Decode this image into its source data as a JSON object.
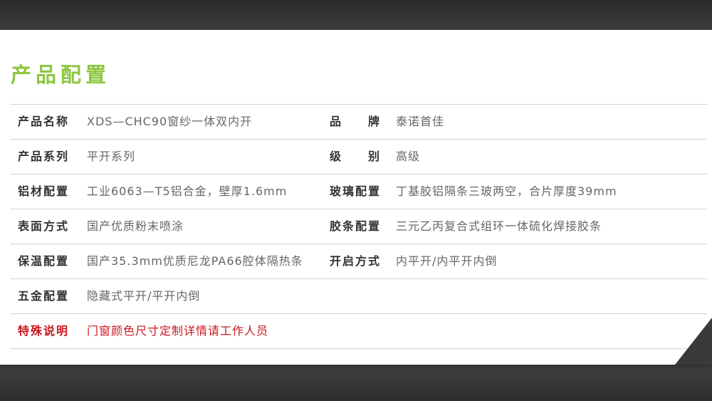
{
  "title": "产品配置",
  "colors": {
    "title": "#8cc63f",
    "highlight": "#c8161d"
  },
  "rows": [
    {
      "l1": "产品名称",
      "v1": "XDS—CHC90窗纱一体双内开",
      "l2": "品　　牌",
      "v2": "泰诺首佳"
    },
    {
      "l1": "产品系列",
      "v1": "平开系列",
      "l2": "级　　别",
      "v2": "高级"
    },
    {
      "l1": "铝材配置",
      "v1": "工业6063—T5铝合金，壁厚1.6mm",
      "l2": "玻璃配置",
      "v2": "丁基胶铝隔条三玻两空，合片厚度39mm"
    },
    {
      "l1": "表面方式",
      "v1": "国产优质粉末喷涂",
      "l2": "胶条配置",
      "v2": "三元乙丙复合式组环一体硫化焊接胶条"
    },
    {
      "l1": "保温配置",
      "v1": "国产35.3mm优质尼龙PA66腔体隔热条",
      "l2": "开启方式",
      "v2": "内平开/内平开内倒"
    },
    {
      "l1": "五金配置",
      "v1": "隐藏式平开/平开内倒"
    },
    {
      "l1": "特殊说明",
      "v1": "门窗颜色尺寸定制详情请工作人员"
    }
  ]
}
